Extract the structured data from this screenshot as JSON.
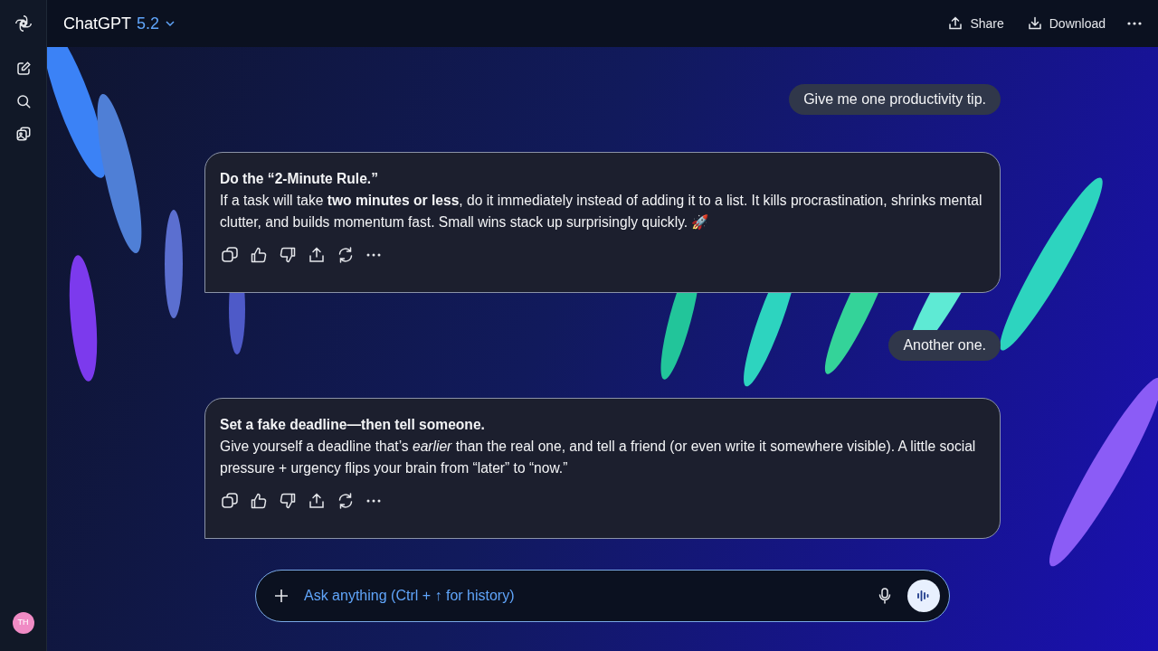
{
  "header": {
    "title": "ChatGPT",
    "model": "5.2",
    "actions": [
      {
        "label": "Share",
        "kind": "share"
      },
      {
        "label": "Download",
        "kind": "download"
      }
    ]
  },
  "messages": [
    {
      "kind": "user",
      "text": "Give me one productivity tip."
    },
    {
      "kind": "assistant",
      "title": "Do the “2-Minute Rule.”",
      "body": "If a task will take **two minutes or less**, do it immediately instead of adding it to a list. It kills procrastination, shrinks mental clutter, and builds momentum fast. Small wins stack up surprisingly quickly. 🚀"
    },
    {
      "kind": "user",
      "text": "Another one."
    },
    {
      "kind": "assistant",
      "title": "Set a fake deadline—then tell someone.",
      "body": "Give yourself a deadline that’s *earlier* than the real one, and tell a friend (or even write it somewhere visible). A little social pressure + urgency flips your brain from “later” to “now.”"
    }
  ],
  "composer": {
    "placeholder": "Ask anything (Ctrl + ↑ for history)"
  },
  "user": {
    "initials": "TH"
  }
}
